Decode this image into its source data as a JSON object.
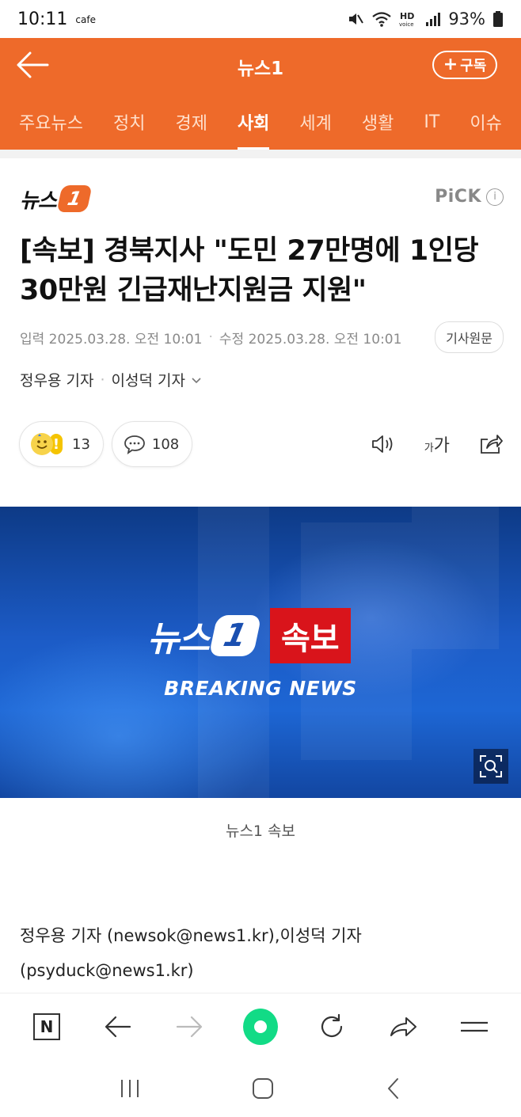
{
  "status_bar": {
    "time": "10:11",
    "app": "cafe",
    "battery": "93%",
    "icons": [
      "mute-icon",
      "wifi-icon",
      "hd-voice-icon",
      "signal-icon",
      "battery-icon"
    ]
  },
  "header": {
    "title": "뉴스1",
    "subscribe_label": "구독",
    "accent_color": "#ee6a2a"
  },
  "tabs": [
    {
      "label": "주요뉴스",
      "active": false
    },
    {
      "label": "정치",
      "active": false
    },
    {
      "label": "경제",
      "active": false
    },
    {
      "label": "사회",
      "active": true
    },
    {
      "label": "세계",
      "active": false
    },
    {
      "label": "생활",
      "active": false
    },
    {
      "label": "IT",
      "active": false
    },
    {
      "label": "이슈",
      "active": false
    }
  ],
  "article": {
    "logo_text": "뉴스",
    "logo_num": "1",
    "pick": "PiCK",
    "headline": "[속보] 경북지사 \"도민 27만명에 1인당 30만원 긴급재난지원금 지원\"",
    "published": "입력 2025.03.28. 오전 10:01",
    "modified": "수정 2025.03.28. 오전 10:01",
    "original_button": "기사원문",
    "reporter1": "정우용 기자",
    "reporter2": "이성덕 기자",
    "reaction_count": "13",
    "comment_count": "108",
    "font_small": "가",
    "font_large": "가",
    "image": {
      "brand_text": "뉴스",
      "brand_num": "1",
      "breaking_kr": "속보",
      "breaking_en": "BREAKING NEWS"
    },
    "caption": "뉴스1 속보",
    "body_line1": "정우용 기자 (newsok@news1.kr),이성덕 기자",
    "body_line2": "(psyduck@news1.kr)"
  },
  "bottom_toolbar": {
    "n_label": "N",
    "icons": [
      "naver-home-icon",
      "back-icon",
      "forward-icon",
      "green-dot-icon",
      "reload-icon",
      "share-icon",
      "menu-icon"
    ]
  },
  "android_nav": {
    "icons": [
      "recents-icon",
      "home-icon",
      "back-nav-icon"
    ]
  }
}
